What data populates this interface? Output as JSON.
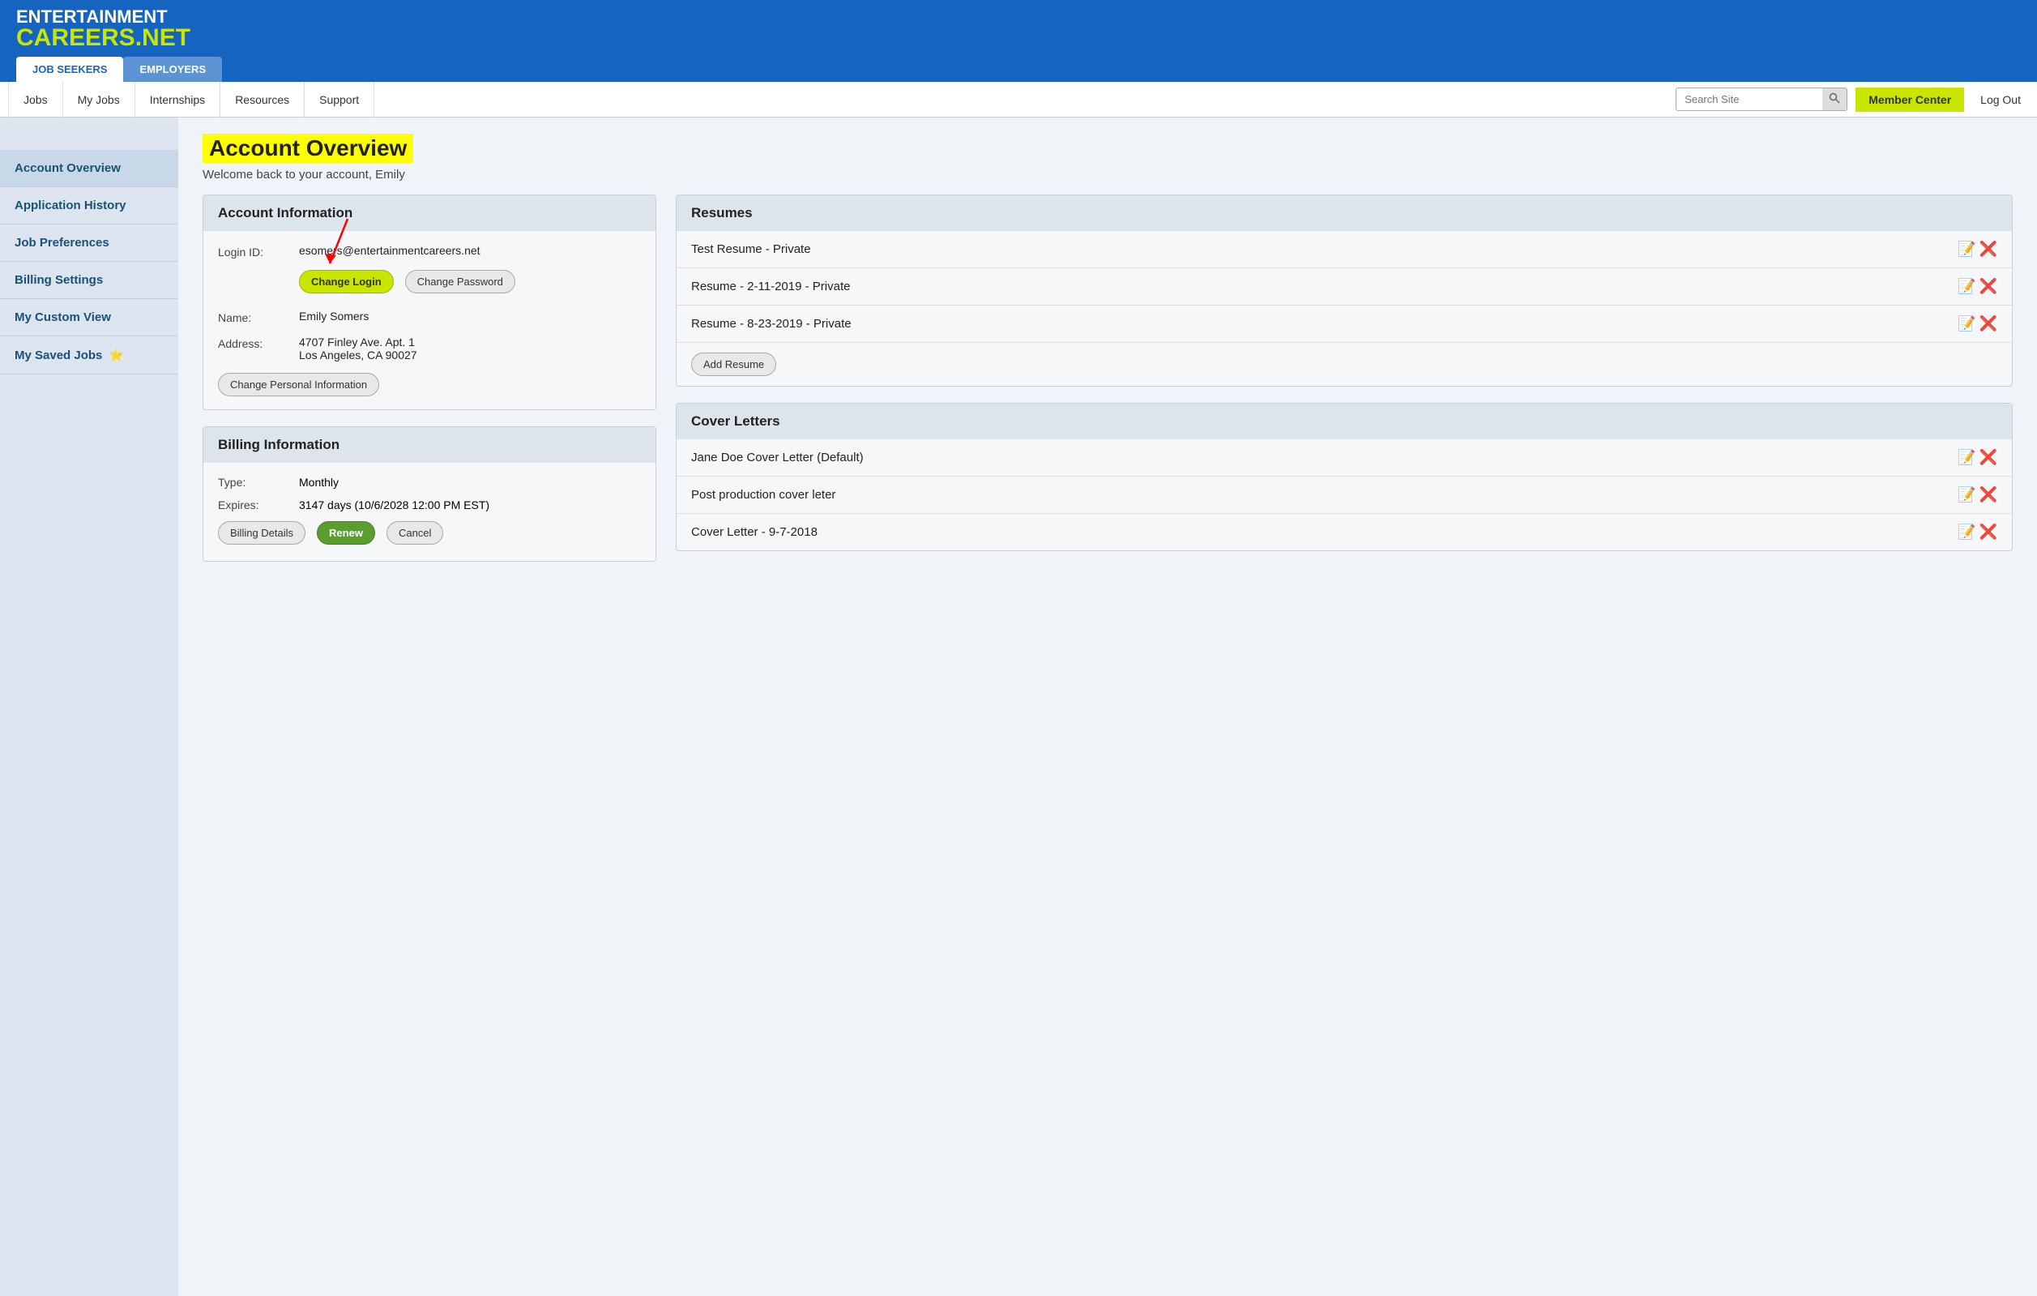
{
  "header": {
    "logo_line1": "ENTERTAINMENT",
    "logo_line2": "CAREERS.NET",
    "tab_jobseekers": "JOB SEEKERS",
    "tab_employers": "EMPLOYERS"
  },
  "topnav": {
    "items": [
      "Jobs",
      "My Jobs",
      "Internships",
      "Resources",
      "Support"
    ],
    "search_placeholder": "Search Site",
    "member_center": "Member Center",
    "logout": "Log Out"
  },
  "sidebar": {
    "items": [
      {
        "label": "Account Overview",
        "id": "account-overview",
        "active": true
      },
      {
        "label": "Application History",
        "id": "application-history",
        "active": false
      },
      {
        "label": "Job Preferences",
        "id": "job-preferences",
        "active": false
      },
      {
        "label": "Billing Settings",
        "id": "billing-settings",
        "active": false
      },
      {
        "label": "My Custom View",
        "id": "my-custom-view",
        "active": false
      },
      {
        "label": "My Saved Jobs",
        "id": "my-saved-jobs",
        "active": false,
        "star": true
      }
    ]
  },
  "main": {
    "page_title": "Account Overview",
    "welcome_text": "Welcome back to your account, Emily",
    "account_info": {
      "section_title": "Account Information",
      "login_label": "Login ID:",
      "login_value": "esomers@entertainmentcareers.net",
      "btn_change_login": "Change Login",
      "btn_change_password": "Change Password",
      "name_label": "Name:",
      "name_value": "Emily Somers",
      "address_label": "Address:",
      "address_line1": "4707 Finley Ave. Apt. 1",
      "address_line2": "Los Angeles, CA 90027",
      "btn_change_personal": "Change Personal Information"
    },
    "billing_info": {
      "section_title": "Billing Information",
      "type_label": "Type:",
      "type_value": "Monthly",
      "expires_label": "Expires:",
      "expires_value": "3147 days  (10/6/2028 12:00 PM EST)",
      "btn_billing_details": "Billing Details",
      "btn_renew": "Renew",
      "btn_cancel": "Cancel"
    },
    "resumes": {
      "section_title": "Resumes",
      "items": [
        {
          "label": "Test Resume - Private"
        },
        {
          "label": "Resume - 2-11-2019 - Private"
        },
        {
          "label": "Resume - 8-23-2019 - Private"
        }
      ],
      "btn_add": "Add Resume"
    },
    "cover_letters": {
      "section_title": "Cover Letters",
      "items": [
        {
          "label": "Jane Doe Cover Letter (Default)"
        },
        {
          "label": "Post production cover leter"
        },
        {
          "label": "Cover Letter - 9-7-2018"
        }
      ]
    }
  }
}
